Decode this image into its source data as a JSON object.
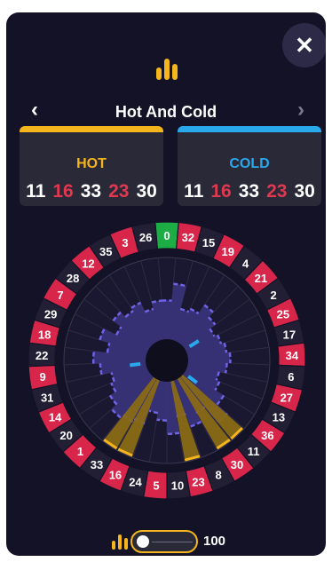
{
  "title": "Hot And Cold",
  "icons": {
    "close": "close-icon",
    "prev": "chevron-left-icon",
    "next": "chevron-right-icon",
    "stats": "bar-chart-icon"
  },
  "nav": {
    "prev_glyph": "‹",
    "next_glyph": "›",
    "close_glyph": "✕"
  },
  "hot": {
    "label": "HOT",
    "numbers": [
      "11",
      "16",
      "33",
      "23",
      "30"
    ]
  },
  "cold": {
    "label": "COLD",
    "numbers": [
      "11",
      "16",
      "33",
      "23",
      "30"
    ]
  },
  "wheel_numbers": [
    "0",
    "32",
    "15",
    "19",
    "4",
    "21",
    "2",
    "25",
    "17",
    "34",
    "6",
    "27",
    "13",
    "36",
    "11",
    "30",
    "8",
    "23",
    "10",
    "5",
    "24",
    "16",
    "33",
    "1",
    "20",
    "14",
    "31",
    "9",
    "22",
    "18",
    "29",
    "7",
    "28",
    "12",
    "35",
    "3",
    "26"
  ],
  "slider": {
    "value": "100"
  },
  "colors": {
    "hot": "#f4b51d",
    "cold": "#2aa8ec",
    "red": "#d8264b",
    "black": "#221f35",
    "green": "#1cad45",
    "panel": "#141226"
  }
}
